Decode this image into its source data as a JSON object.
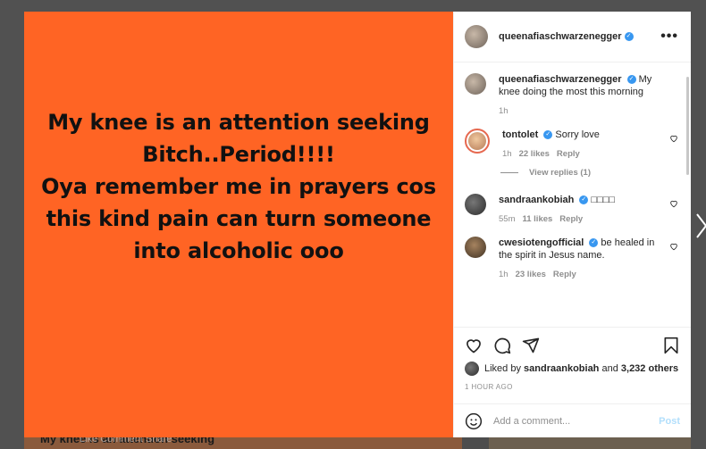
{
  "post": {
    "image_text": [
      "My knee is an attention seeking",
      "Bitch..Period!!!!",
      "Oya remember me in prayers cos",
      "this kind pain can turn someone",
      "into alcoholic ooo"
    ],
    "image_color": "#ff6424"
  },
  "header": {
    "username": "queenafiaschwarzenegger",
    "verified_mark": "✓",
    "more_label": "•••"
  },
  "caption": {
    "username": "queenafiaschwarzenegger",
    "text": "My knee doing the most this morning",
    "time": "1h"
  },
  "comments": [
    {
      "username": "tontolet",
      "text": "Sorry love",
      "time": "1h",
      "likes": "22 likes",
      "reply": "Reply"
    },
    {
      "username": "sandraankobiah",
      "text": "□□□□",
      "time": "55m",
      "likes": "11 likes",
      "reply": "Reply"
    },
    {
      "username": "cwesiotengofficial",
      "text": "be healed in the spirit in Jesus name.",
      "time": "1h",
      "likes": "23 likes",
      "reply": "Reply"
    }
  ],
  "view_replies": "View replies (1)",
  "likes": {
    "prefix": "Liked by ",
    "user": "sandraankobiah",
    "middle": " and ",
    "others": "3,232 others"
  },
  "timestamp": "1 HOUR AGO",
  "add_comment": {
    "placeholder": "Add a comment...",
    "post_label": "Post"
  },
  "background": {
    "caption": "My knee is an attention seeking",
    "actions": "Like      Comment                Share"
  },
  "colors": {
    "verified": "#3897f0",
    "post_button": "#b2dffc"
  }
}
